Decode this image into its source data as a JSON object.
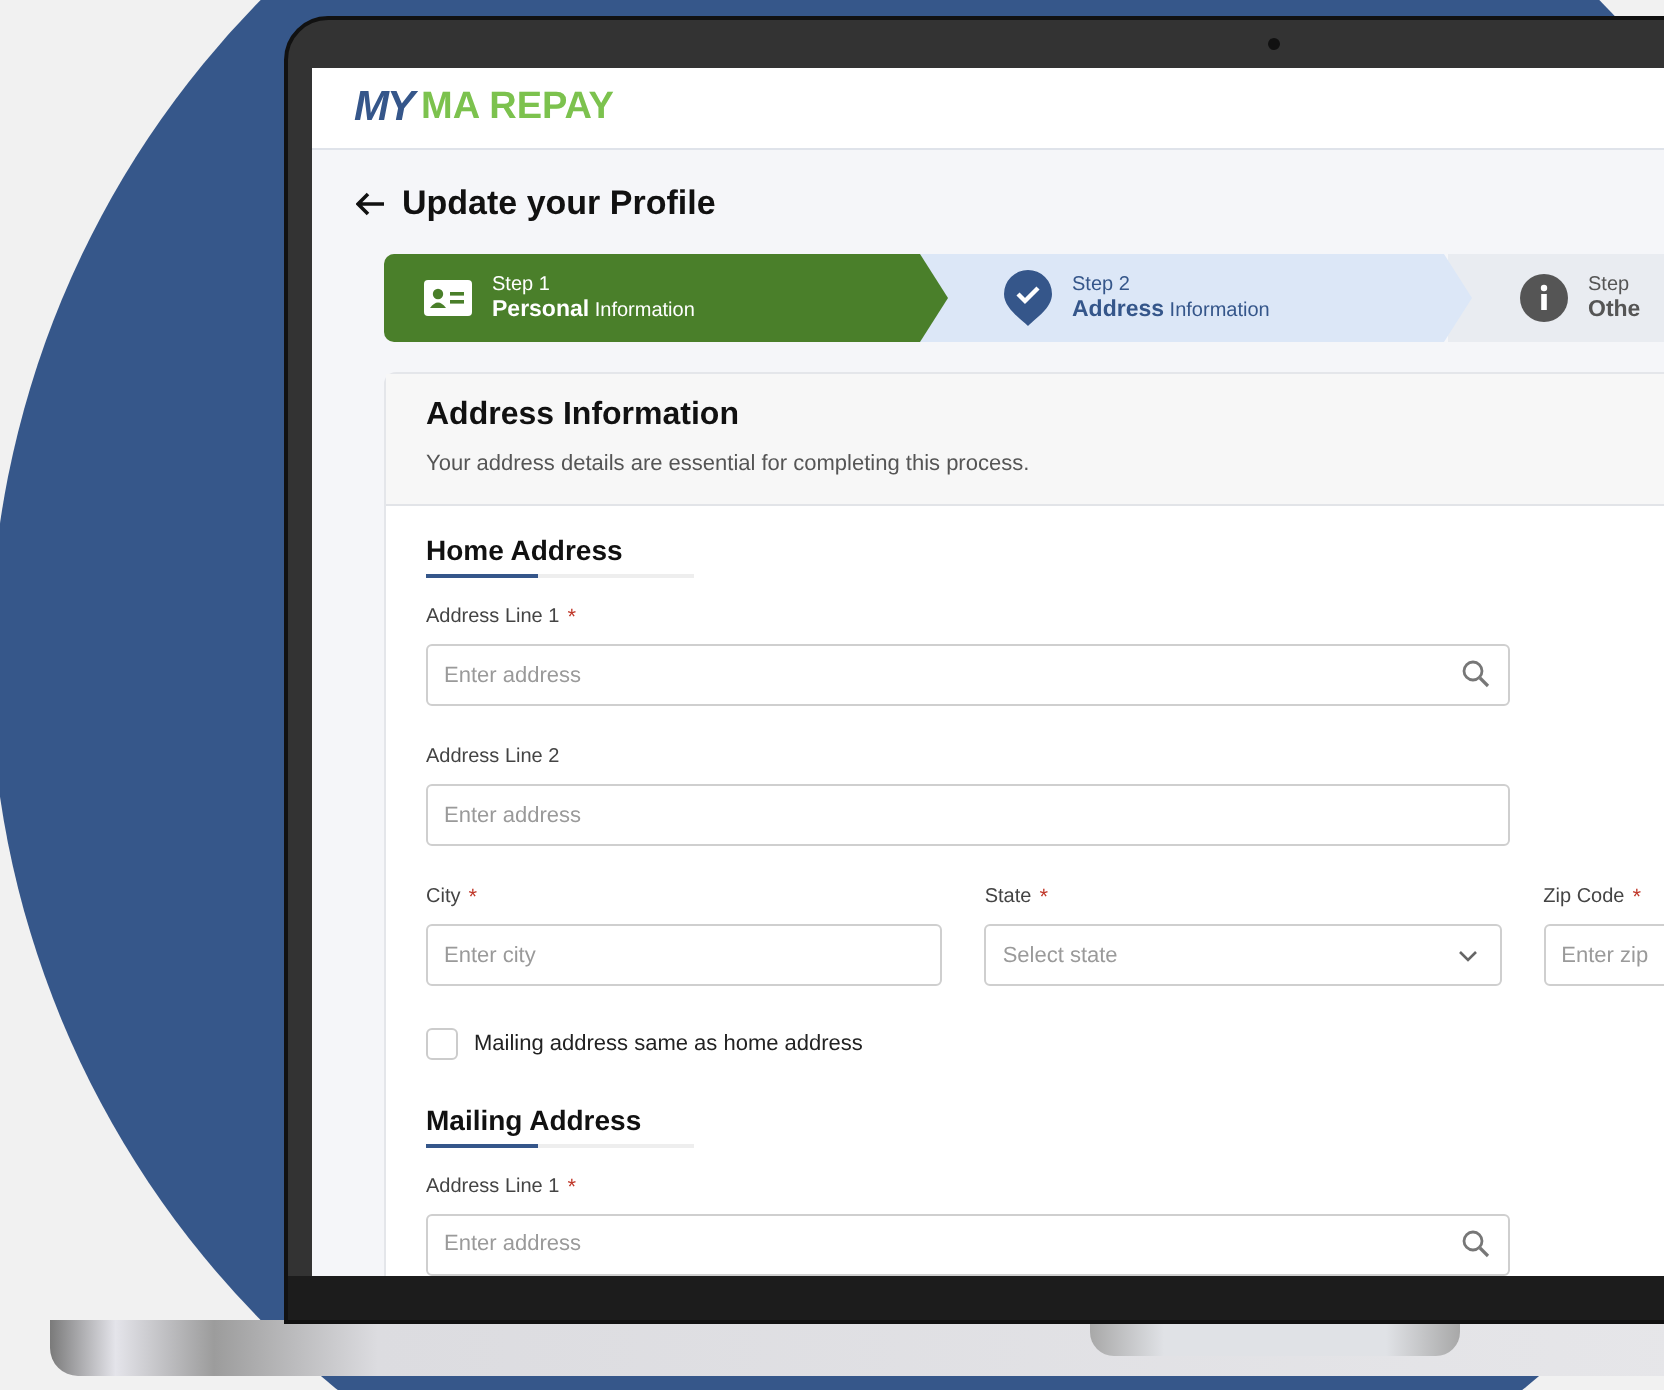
{
  "logo": {
    "first": "MY",
    "second": "MA REPAY"
  },
  "page": {
    "title": "Update your Profile"
  },
  "steps": [
    {
      "label": "Step 1",
      "title": "**Personal** Information",
      "completed": true,
      "selected": false
    },
    {
      "label": "Step 2",
      "title": "**Address** Information",
      "completed": false,
      "selected": true
    },
    {
      "label": "Step",
      "title": "**Othe**",
      "completed": false,
      "selected": false
    }
  ],
  "card": {
    "title": "Address Information",
    "subtitle": "Your address details are essential for completing this process."
  },
  "sections": [
    {
      "heading": "Home Address",
      "rows": [
        [
          {
            "kind": "search",
            "label": "Address Line 1",
            "required_mark": "*",
            "placeholder": "Enter address"
          }
        ],
        [
          {
            "kind": "text",
            "label": "Address Line 2",
            "placeholder": "Enter address"
          }
        ],
        [
          {
            "kind": "text",
            "label": "City",
            "required_mark": "*",
            "placeholder": "Enter city"
          },
          {
            "kind": "select",
            "label": "State",
            "required_mark": "*",
            "placeholder": "Select state"
          },
          {
            "kind": "text",
            "label": "Zip Code",
            "required_mark": "*",
            "placeholder": "Enter zip"
          }
        ]
      ],
      "checkbox": {
        "label": "Mailing address same as home address",
        "checked": false
      }
    },
    {
      "heading": "Mailing Address",
      "rows": [
        [
          {
            "kind": "search",
            "label": "Address Line 1",
            "required_mark": "*",
            "placeholder": "Enter address"
          }
        ]
      ]
    }
  ]
}
